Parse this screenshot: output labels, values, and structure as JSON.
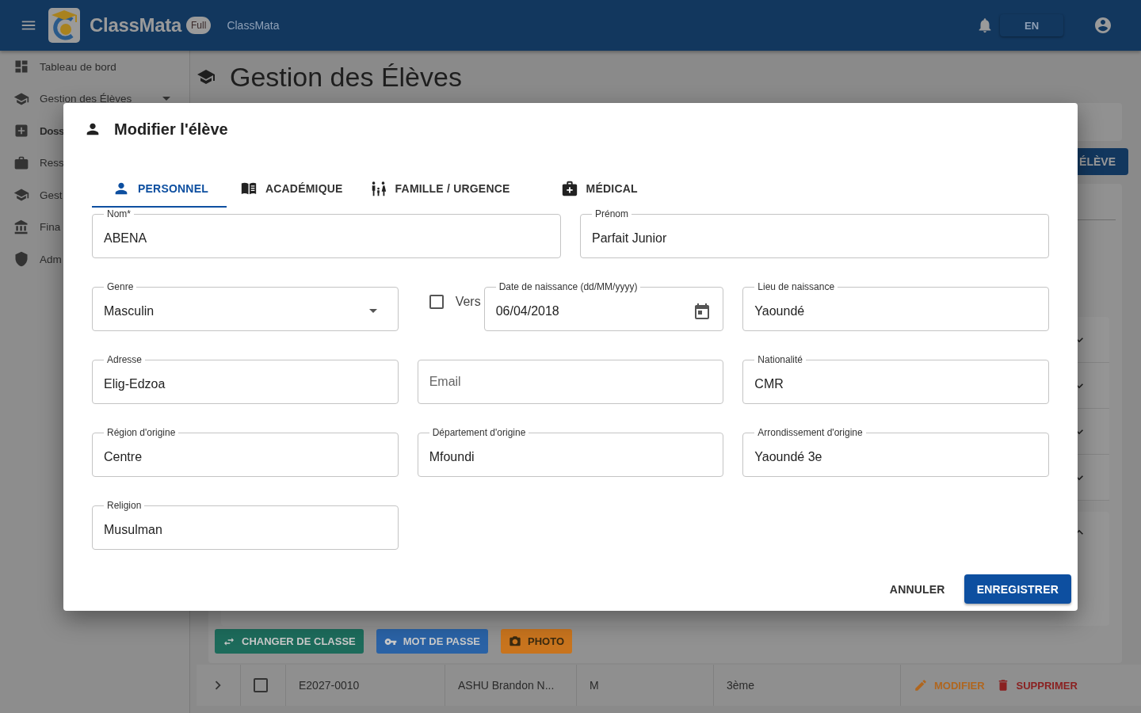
{
  "app_bar": {
    "brand": "ClassMata",
    "badge": "Full",
    "subtitle": "ClassMata",
    "language": "EN"
  },
  "sidebar": {
    "items": [
      {
        "label": "Tableau de bord",
        "selected": false
      },
      {
        "label": "Gestion des Élèves",
        "selected": false,
        "expanded": false
      },
      {
        "label": "Doss",
        "selected": true
      },
      {
        "label": "Ress",
        "selected": false
      },
      {
        "label": "Gest",
        "selected": false
      },
      {
        "label": "Fina",
        "selected": false
      },
      {
        "label": "Adm",
        "selected": false
      }
    ]
  },
  "page": {
    "title": "Gestion des Élèves",
    "add_button": "ÉLÈVE",
    "sections": [
      {
        "expanded": false
      },
      {
        "expanded": false
      },
      {
        "expanded": false
      },
      {
        "expanded": false
      },
      {
        "expanded": true
      }
    ],
    "actions": [
      {
        "label": "CHANGER DE CLASSE",
        "color": "#1d6b5b"
      },
      {
        "label": "MOT DE PASSE",
        "color": "#2a62a5"
      },
      {
        "label": "PHOTO",
        "color": "#c8741e"
      }
    ],
    "table": {
      "rows": [
        {
          "expanded": false,
          "checked": false,
          "cells": [
            "E2027-0010",
            "ASHU Brandon N...",
            "M",
            "3ème"
          ],
          "actions": [
            "MODIFIER",
            "SUPPRIMER"
          ]
        }
      ]
    }
  },
  "dialog": {
    "title": "Modifier l'élève",
    "tabs": [
      {
        "label": "PERSONNEL",
        "selected": true
      },
      {
        "label": "ACADÉMIQUE",
        "selected": false
      },
      {
        "label": "FAMILLE / URGENCE",
        "selected": false
      },
      {
        "label": "MÉDICAL",
        "selected": false
      }
    ],
    "rows": [
      {
        "fields": [
          {
            "kind": "text",
            "label": "Nom*",
            "value": "ABENA"
          },
          {
            "kind": "text",
            "label": "Prénom",
            "value": "Parfait Junior"
          }
        ]
      },
      {
        "fields": [
          {
            "kind": "select",
            "label": "Genre",
            "value": "Masculin"
          },
          {
            "kind": "date",
            "checkbox": {
              "label": "Vers",
              "checked": false
            },
            "label": "Date de naissance (dd/MM/yyyy)",
            "value": "06/04/2018"
          },
          {
            "kind": "text",
            "label": "Lieu de naissance",
            "value": "Yaoundé"
          }
        ]
      },
      {
        "fields": [
          {
            "kind": "text",
            "label": "Adresse",
            "value": "Elig-Edzoa"
          },
          {
            "kind": "text",
            "placeholder": "Email"
          },
          {
            "kind": "text",
            "label": "Nationalité",
            "value": "CMR"
          }
        ]
      },
      {
        "fields": [
          {
            "kind": "text",
            "label": "Région d'origine",
            "value": "Centre"
          },
          {
            "kind": "text",
            "label": "Département d'origine",
            "value": "Mfoundi"
          },
          {
            "kind": "text",
            "label": "Arrondissement d'origine",
            "value": "Yaoundé 3e"
          }
        ]
      },
      {
        "fields": [
          {
            "kind": "text",
            "label": "Religion",
            "value": "Musulman"
          }
        ]
      }
    ],
    "buttons": [
      {
        "kind": "text",
        "label": "ANNULER"
      },
      {
        "kind": "contained",
        "label": "ENREGISTRER"
      }
    ]
  }
}
